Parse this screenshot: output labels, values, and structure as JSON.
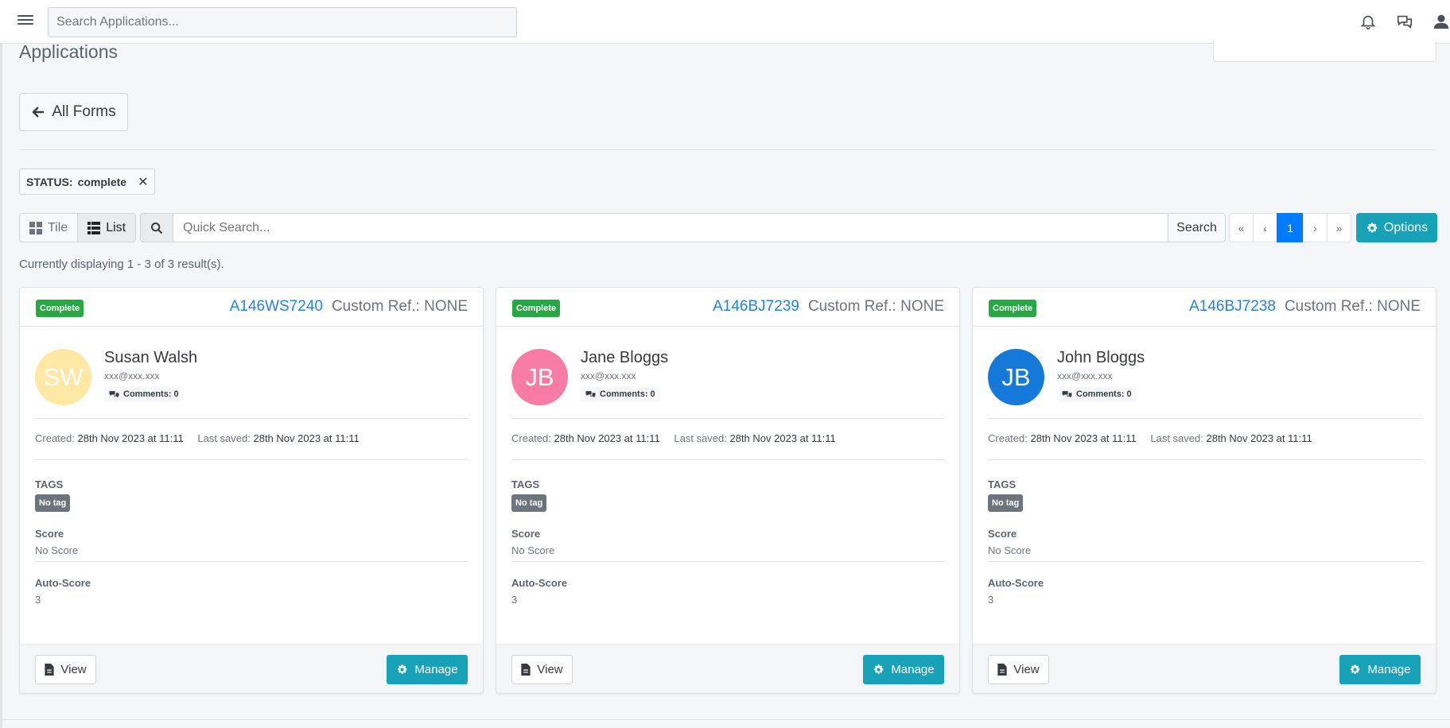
{
  "navbar": {
    "search_placeholder": "Search Applications..."
  },
  "page": {
    "title": "Applications",
    "back_button": "All Forms",
    "filter_label": "STATUS:",
    "filter_value": "complete",
    "filter_remove": "✕"
  },
  "toolbar": {
    "tile_label": "Tile",
    "list_label": "List",
    "quick_search_placeholder": "Quick Search...",
    "search_button": "Search",
    "pager": [
      "«",
      "‹",
      "1",
      "›",
      "»"
    ],
    "current_page": "1",
    "options_button": "Options"
  },
  "results_text": "Currently displaying 1 - 3 of 3 result(s).",
  "labels": {
    "created": "Created:",
    "last_saved": "Last saved:",
    "tags": "TAGS",
    "score": "Score",
    "auto_score": "Auto-Score",
    "view": "View",
    "manage": "Manage",
    "comments_prefix": "Comments:"
  },
  "cards": [
    {
      "status": "Complete",
      "ref": "A146WS7240",
      "custom_ref": "Custom Ref.: NONE",
      "initials": "SW",
      "avatar_color": "#ffe8a3",
      "name": "Susan Walsh",
      "email": "xxx@xxx.xxx",
      "comments": "Comments: 0",
      "created": "28th Nov 2023 at 11:11",
      "last_saved": "28th Nov 2023 at 11:11",
      "tag": "No tag",
      "score": "No Score",
      "auto_score": "3"
    },
    {
      "status": "Complete",
      "ref": "A146BJ7239",
      "custom_ref": "Custom Ref.: NONE",
      "initials": "JB",
      "avatar_color": "#f77ba5",
      "name": "Jane Bloggs",
      "email": "xxx@xxx.xxx",
      "comments": "Comments: 0",
      "created": "28th Nov 2023 at 11:11",
      "last_saved": "28th Nov 2023 at 11:11",
      "tag": "No tag",
      "score": "No Score",
      "auto_score": "3"
    },
    {
      "status": "Complete",
      "ref": "A146BJ7238",
      "custom_ref": "Custom Ref.: NONE",
      "initials": "JB",
      "avatar_color": "#1479d8",
      "name": "John Bloggs",
      "email": "xxx@xxx.xxx",
      "comments": "Comments: 0",
      "created": "28th Nov 2023 at 11:11",
      "last_saved": "28th Nov 2023 at 11:11",
      "tag": "No tag",
      "score": "No Score",
      "auto_score": "3"
    }
  ],
  "colors": {
    "accent": "#17a2b8",
    "link": "#2383e2",
    "success": "#28a745",
    "page_active": "#007bff"
  }
}
